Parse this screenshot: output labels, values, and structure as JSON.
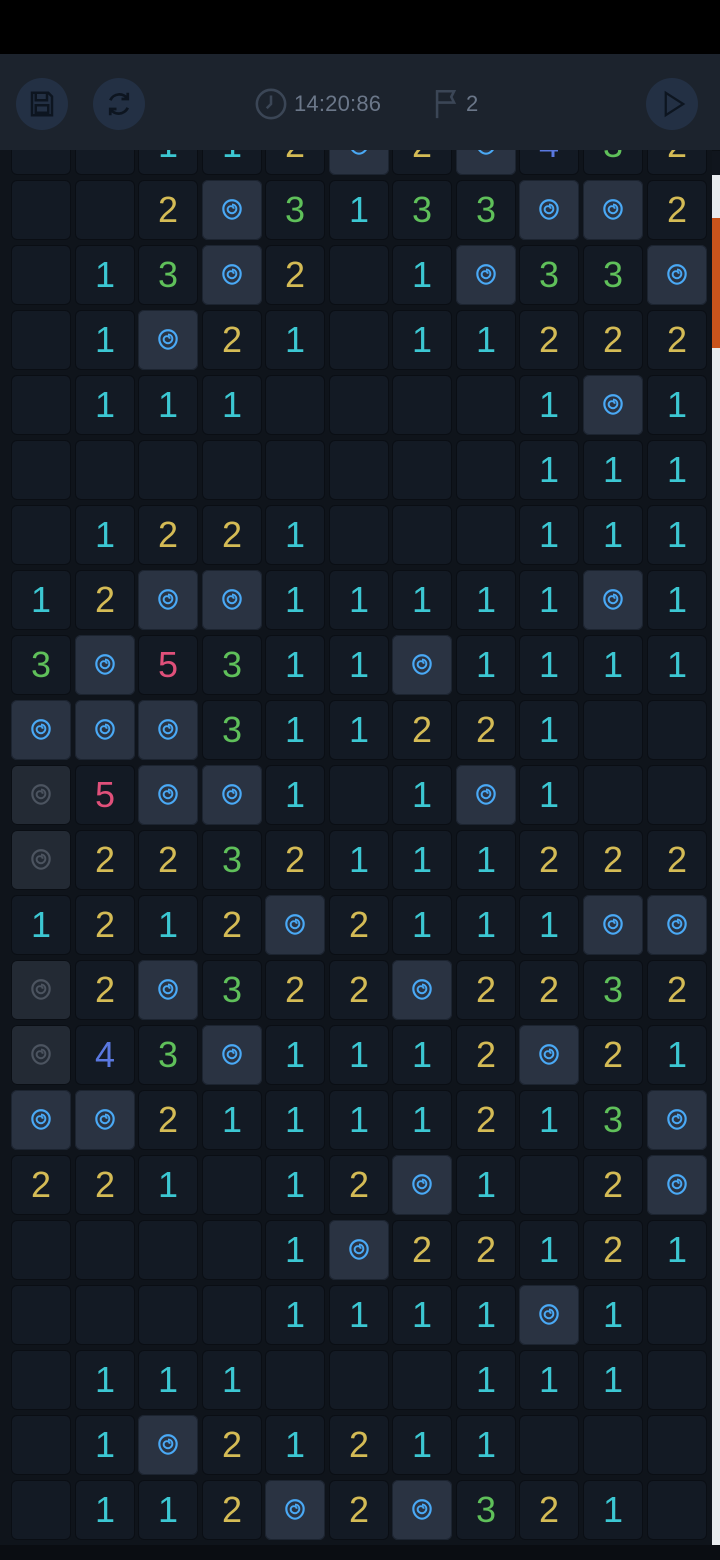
{
  "status_bar": {},
  "toolbar": {
    "save_icon": "save-icon",
    "restart_icon": "restart-icon",
    "timer": "14:20:86",
    "flags": "2",
    "play_icon": "play-icon"
  },
  "colors": {
    "1": "#3cc7d2",
    "2": "#d4bb55",
    "3": "#5fc05a",
    "4": "#5a78e0",
    "5": "#e0507a",
    "rose": "#4aa9f5"
  },
  "board": {
    "partial_top_row": [
      "",
      "",
      "1",
      "1",
      "2",
      "R",
      "2",
      "R",
      "4",
      "3",
      "2"
    ],
    "rows": [
      [
        "",
        "",
        "2",
        "R",
        "3",
        "1",
        "3",
        "3",
        "R",
        "R",
        "2"
      ],
      [
        "",
        "1",
        "3",
        "R",
        "2",
        "",
        "1",
        "R",
        "3",
        "3",
        "R"
      ],
      [
        "",
        "1",
        "R",
        "2",
        "1",
        "",
        "1",
        "1",
        "2",
        "2",
        "2"
      ],
      [
        "",
        "1",
        "1",
        "1",
        "",
        "",
        "",
        "",
        "1",
        "R",
        "1"
      ],
      [
        "",
        "",
        "",
        "",
        "",
        "",
        "",
        "",
        "1",
        "1",
        "1"
      ],
      [
        "",
        "1",
        "2",
        "2",
        "1",
        "",
        "",
        "",
        "1",
        "1",
        "1"
      ],
      [
        "1",
        "2",
        "R",
        "R",
        "1",
        "1",
        "1",
        "1",
        "1",
        "R",
        "1"
      ],
      [
        "3",
        "R",
        "5",
        "3",
        "1",
        "1",
        "R",
        "1",
        "1",
        "1",
        "1"
      ],
      [
        "R",
        "R",
        "R",
        "3",
        "1",
        "1",
        "2",
        "2",
        "1",
        "",
        ""
      ],
      [
        "F",
        "5",
        "R",
        "R",
        "1",
        "",
        "1",
        "R",
        "1",
        "",
        ""
      ],
      [
        "F",
        "2",
        "2",
        "3",
        "2",
        "1",
        "1",
        "1",
        "2",
        "2",
        "2"
      ],
      [
        "1",
        "2",
        "1",
        "2",
        "R",
        "2",
        "1",
        "1",
        "1",
        "R",
        "R"
      ],
      [
        "F",
        "2",
        "R",
        "3",
        "2",
        "2",
        "R",
        "2",
        "2",
        "3",
        "2"
      ],
      [
        "F",
        "4",
        "3",
        "R",
        "1",
        "1",
        "1",
        "2",
        "R",
        "2",
        "1"
      ],
      [
        "R",
        "R",
        "2",
        "1",
        "1",
        "1",
        "1",
        "2",
        "1",
        "3",
        "R"
      ],
      [
        "2",
        "2",
        "1",
        "",
        "1",
        "2",
        "R",
        "1",
        "",
        "2",
        "R"
      ],
      [
        "",
        "",
        "",
        "",
        "1",
        "R",
        "2",
        "2",
        "1",
        "2",
        "1"
      ],
      [
        "",
        "",
        "",
        "",
        "1",
        "1",
        "1",
        "1",
        "R",
        "1",
        ""
      ],
      [
        "",
        "1",
        "1",
        "1",
        "",
        "",
        "",
        "1",
        "1",
        "1",
        ""
      ],
      [
        "",
        "1",
        "R",
        "2",
        "1",
        "2",
        "1",
        "1",
        "",
        "",
        ""
      ],
      [
        "",
        "1",
        "1",
        "2",
        "R",
        "2",
        "R",
        "3",
        "2",
        "1",
        ""
      ]
    ]
  }
}
